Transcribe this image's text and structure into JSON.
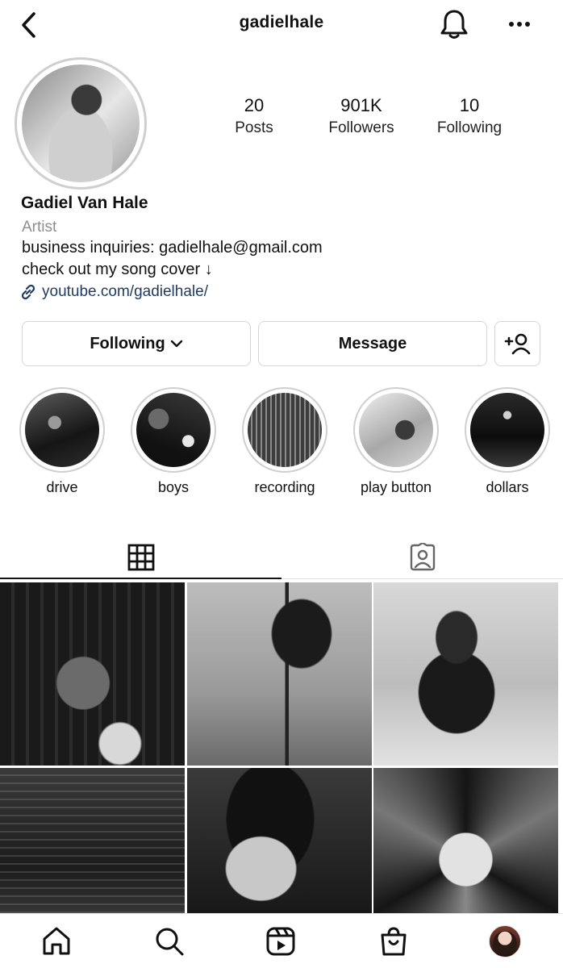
{
  "header": {
    "username": "gadielhale"
  },
  "profile": {
    "stats": [
      {
        "value": "20",
        "label": "Posts"
      },
      {
        "value": "901K",
        "label": "Followers"
      },
      {
        "value": "10",
        "label": "Following"
      }
    ],
    "name": "Gadiel Van Hale",
    "category": "Artist",
    "bio_lines": [
      "business inquiries: gadielhale@gmail.com",
      "check out my song cover ↓"
    ],
    "link": "youtube.com/gadielhale/"
  },
  "actions": {
    "following_label": "Following",
    "message_label": "Message"
  },
  "highlights": [
    {
      "label": "drive"
    },
    {
      "label": "boys"
    },
    {
      "label": "recording"
    },
    {
      "label": "play button"
    },
    {
      "label": "dollars"
    }
  ],
  "tabs": [
    {
      "name": "posts-grid-tab",
      "icon": "grid-icon",
      "active": true
    },
    {
      "name": "tagged-tab",
      "icon": "tagged-person-icon",
      "active": false
    }
  ],
  "posts": [
    {
      "name": "post-1"
    },
    {
      "name": "post-2"
    },
    {
      "name": "post-3"
    },
    {
      "name": "post-4"
    },
    {
      "name": "post-5"
    },
    {
      "name": "post-6"
    }
  ],
  "bottom_nav": [
    "home-icon",
    "search-icon",
    "reels-icon",
    "shop-icon",
    "profile-avatar"
  ],
  "colors": {
    "link": "#1f3a5f",
    "muted": "#8e8e8e",
    "border": "#d6d6d6",
    "text": "#111111"
  }
}
